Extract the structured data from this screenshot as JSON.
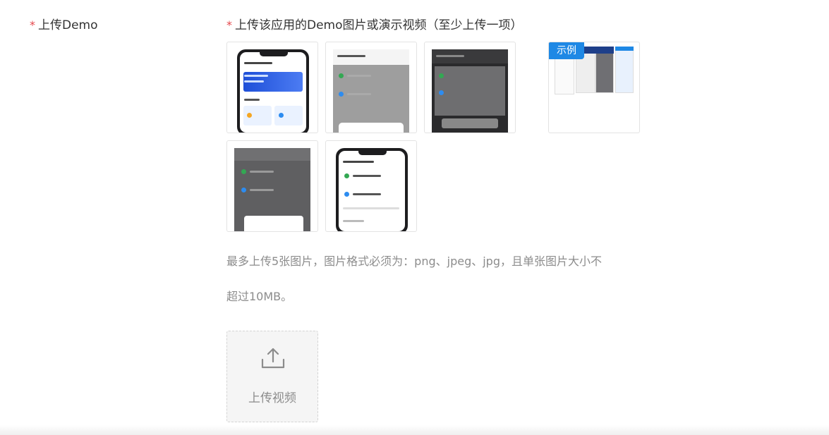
{
  "form": {
    "required_mark": "*",
    "field_label": "上传Demo",
    "sub_label": "上传该应用的Demo图片或演示视频（至少上传一项）"
  },
  "thumbnails": [
    {
      "name": "demo-image-1",
      "theme": "light"
    },
    {
      "name": "demo-image-2",
      "theme": "gray"
    },
    {
      "name": "demo-image-3",
      "theme": "dark"
    },
    {
      "name": "demo-image-4",
      "theme": "dark"
    },
    {
      "name": "demo-image-5",
      "theme": "light"
    }
  ],
  "example": {
    "tag": "示例"
  },
  "hint": {
    "line1": "最多上传5张图片，图片格式必须为：png、jpeg、jpg，且单张图片大小不",
    "line2": "超过10MB。"
  },
  "upload_video": {
    "label": "上传视频",
    "icon": "upload-icon"
  },
  "colors": {
    "required": "#e5484d",
    "accent": "#1e88e5",
    "hint_text": "#8c8c8c"
  }
}
